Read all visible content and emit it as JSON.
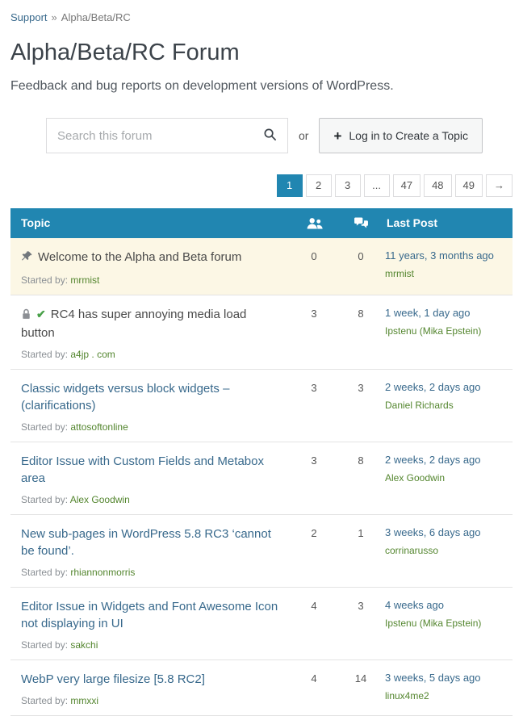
{
  "breadcrumb": {
    "link": "Support",
    "separator": "»",
    "current": "Alpha/Beta/RC"
  },
  "header": {
    "title": "Alpha/Beta/RC Forum",
    "description": "Feedback and bug reports on development versions of WordPress."
  },
  "search": {
    "placeholder": "Search this forum",
    "or_text": "or",
    "login_button": "Log in to Create a Topic"
  },
  "pagination": {
    "current": "1",
    "pages": [
      "1",
      "2",
      "3",
      "...",
      "47",
      "48",
      "49",
      "→"
    ]
  },
  "table": {
    "topic_header": "Topic",
    "last_post_header": "Last Post",
    "started_by_label": "Started by:",
    "voices_icon": "users-icon",
    "replies_icon": "speech-bubbles-icon"
  },
  "rows": [
    {
      "title": "Welcome to the Alpha and Beta forum",
      "author": "mrmist",
      "voices": "0",
      "replies": "0",
      "freshness": "11 years, 3 months ago",
      "last_poster": "mrmist"
    },
    {
      "title": "RC4 has super annoying media load button",
      "author": "a4jp . com",
      "voices": "3",
      "replies": "8",
      "freshness": "1 week, 1 day ago",
      "last_poster": "Ipstenu (Mika Epstein)"
    },
    {
      "title": "Classic widgets versus block widgets – (clarifications)",
      "author": "attosoftonline",
      "voices": "3",
      "replies": "3",
      "freshness": "2 weeks, 2 days ago",
      "last_poster": "Daniel Richards"
    },
    {
      "title": "Editor Issue with Custom Fields and Metabox area",
      "author": "Alex Goodwin",
      "voices": "3",
      "replies": "8",
      "freshness": "2 weeks, 2 days ago",
      "last_poster": "Alex Goodwin"
    },
    {
      "title": "New sub-pages in WordPress 5.8 RC3 ‘cannot be found’.",
      "author": "rhiannonmorris",
      "voices": "2",
      "replies": "1",
      "freshness": "3 weeks, 6 days ago",
      "last_poster": "corrinarusso"
    },
    {
      "title": "Editor Issue in Widgets and Font Awesome Icon not displaying in UI",
      "author": "sakchi",
      "voices": "4",
      "replies": "3",
      "freshness": "4 weeks ago",
      "last_poster": "Ipstenu (Mika Epstein)"
    },
    {
      "title": "WebP very large filesize [5.8 RC2]",
      "author": "mmxxi",
      "voices": "4",
      "replies": "14",
      "freshness": "3 weeks, 5 days ago",
      "last_poster": "linux4me2"
    }
  ],
  "colors": {
    "table_header_bg": "#2186b1",
    "link_blue": "#38698c",
    "visited_link": "#4a4a4a",
    "author_green": "#54862f",
    "sticky_row_bg": "#fcf7e5",
    "resolved_check_green": "#48a048"
  }
}
